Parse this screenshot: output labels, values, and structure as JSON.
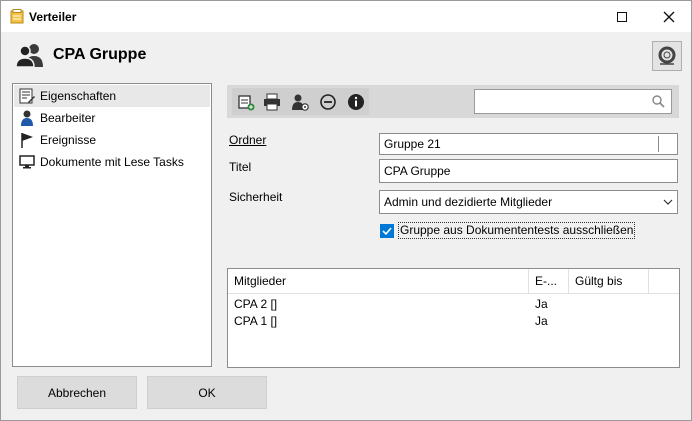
{
  "window": {
    "title": "Verteiler"
  },
  "header": {
    "title": "CPA Gruppe",
    "icon": "group-icon",
    "help_icon": "lifebuoy-icon"
  },
  "nav": {
    "items": [
      {
        "label": "Eigenschaften",
        "icon": "properties-icon",
        "selected": true
      },
      {
        "label": "Bearbeiter",
        "icon": "user-icon",
        "selected": false
      },
      {
        "label": "Ereignisse",
        "icon": "flag-icon",
        "selected": false
      },
      {
        "label": "Dokumente mit Lese Tasks",
        "icon": "monitor-icon",
        "selected": false
      }
    ]
  },
  "toolbar": {
    "buttons": [
      "document-add-icon",
      "print-icon",
      "user-settings-icon",
      "remove-icon",
      "info-icon"
    ],
    "search": {
      "value": "",
      "placeholder": ""
    }
  },
  "form": {
    "ordner": {
      "label": "Ordner",
      "value": "Gruppe 21"
    },
    "titel": {
      "label": "Titel",
      "value": "CPA Gruppe"
    },
    "sicherheit": {
      "label": "Sicherheit",
      "value": "Admin und dezidierte Mitglieder"
    },
    "exclude": {
      "label": "Gruppe aus Dokumententests ausschließen",
      "checked": true
    }
  },
  "members": {
    "columns": [
      "Mitglieder",
      "E-...",
      "Gültg bis"
    ],
    "rows": [
      {
        "name": "CPA 2 []",
        "e": "Ja",
        "valid": ""
      },
      {
        "name": "CPA 1 []",
        "e": "Ja",
        "valid": ""
      }
    ]
  },
  "buttons": {
    "cancel": "Abbrechen",
    "ok": "OK"
  },
  "colors": {
    "accent": "#0078d7",
    "toolbar": "#d8d8d8"
  }
}
